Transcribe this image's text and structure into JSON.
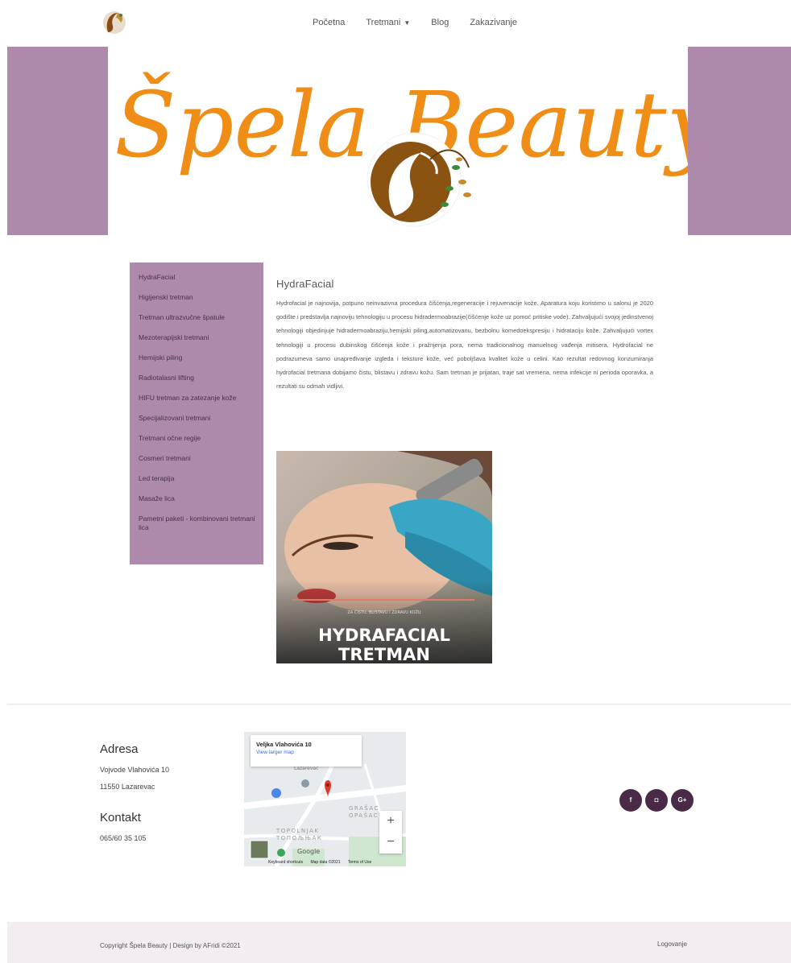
{
  "nav": {
    "items": [
      {
        "label": "Početna"
      },
      {
        "label": "Tretmani"
      },
      {
        "label": "Blog"
      },
      {
        "label": "Zakazivanje"
      }
    ]
  },
  "hero": {
    "brand": "Špela Beauty"
  },
  "sidebar": {
    "items": [
      "HydraFacial",
      "Higijenski tretman",
      "Tretman ultrazvučne špatule",
      "Mezoterapijski tretmani",
      "Hemijski piling",
      "Radiotalasni lifting",
      "HIFU tretman za zatezanje kože",
      "Specijalizovani tretmani",
      "Tretmani očne regije",
      "Cosmeri tretmani",
      "Led terapija",
      "Masaže lica",
      "Pametni paketi - kombinovani tretmani lica"
    ]
  },
  "content": {
    "title": "HydraFacial",
    "text": "Hydrofacial je najnovija, potpuno neinvazivna procedura čišćenja,regeneracije i rejuvenacije kože. Aparatura koju koristimo u salonu je 2020 godište i predstavlja najnoviju tehnologiju u procesu hidradermoabrazije(čišćenje kože uz pomoć pritiske vode). Zahvaljujući svojoj jedinstvenoj tehnologiji objedinjuje hidradermoabraziju,hemijski piling,automatizovanu, bezbolnu komedoekspresiju i hidrataciju kože. Zahvaljujući vortex tehnologiji u procesu dubinskog čišćenja kože i pražnjenja pora, nema tradicionalnog manuelnog vađenja mitisera. Hydrofacial ne podrazumeva samo unapređivanje izgleda i teksture kože, već poboljšava kvalitet kože u celini. Kao rezultat redovnog konzumiranja hydrofacial tretmana dobijamo čistu, blistavu i zdravu kožu. Sam tretman je prijatan, traje sat vremena, nema infekcije ni perioda oporavka, a rezultati su odmah vidljivi.",
    "promo_small": "ZA ČISTU, BLISTAVU I ZDRAVU KOŽU",
    "promo_line1": "HYDRAFACIAL",
    "promo_line2": "TRETMAN"
  },
  "footer": {
    "address_heading": "Adresa",
    "address_line1": "Vojvode Vlahovića 10",
    "address_line2": "11550 Lazarevac",
    "contact_heading": "Kontakt",
    "phone": "065/60 35 105",
    "map": {
      "card_title": "Veljka Vlahovića 10",
      "card_link": "View larger map",
      "label_lazarevac": "Lazarevac",
      "label_grasac": "GRAŠAC",
      "label_opasac": "OPAŠAC",
      "label_topolnjak": "TOPOLNJAK",
      "label_topolnjak_cyr": "ТОПОЉЊАК",
      "label_google": "Google",
      "foot_shortcuts": "Keyboard shortcuts",
      "foot_mapdata": "Map data ©2021",
      "foot_terms": "Terms of Use"
    },
    "socials": [
      "f",
      "◘",
      "G+"
    ],
    "copyright": "Copyright Špela Beauty | Design by AFridi ©2021",
    "login": "Logovanje"
  },
  "colors": {
    "purple": "#ad8aac",
    "orange": "#ef8d16",
    "dark_purple": "#4a2b47"
  }
}
